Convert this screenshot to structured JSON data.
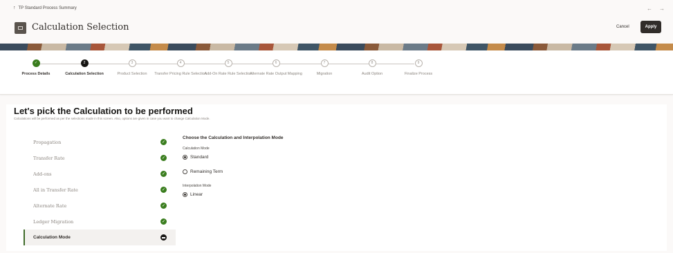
{
  "breadcrumb": {
    "label": "TP Standard Process Summary"
  },
  "header": {
    "title": "Calculation Selection",
    "cancel_label": "Cancel",
    "apply_label": "Apply"
  },
  "train": {
    "steps": [
      {
        "label": "Process Details",
        "state": "done",
        "glyph": "✓"
      },
      {
        "label": "Calculation Selection",
        "state": "current",
        "glyph": "2"
      },
      {
        "label": "Product Selection",
        "state": "pending",
        "glyph": "3"
      },
      {
        "label": "Transfer Pricing Rule Selection",
        "state": "pending",
        "glyph": "4"
      },
      {
        "label": "Add-On Rate Rule Selection",
        "state": "pending",
        "glyph": "5"
      },
      {
        "label": "Alternate Rate Output Mapping",
        "state": "pending",
        "glyph": "6"
      },
      {
        "label": "Migration",
        "state": "pending",
        "glyph": "7"
      },
      {
        "label": "Audit Option",
        "state": "pending",
        "glyph": "8"
      },
      {
        "label": "Finalize Process",
        "state": "pending",
        "glyph": "9"
      }
    ]
  },
  "main": {
    "heading": "Let's pick the Calculation to be performed",
    "subtext": "Calculations will be performed as per the selections made in this screen. Also, options are given in case you want to change Calculation Mode.",
    "calculations": [
      {
        "label": "Propagation",
        "status": "done"
      },
      {
        "label": "Transfer Rate",
        "status": "done"
      },
      {
        "label": "Add-ons",
        "status": "done"
      },
      {
        "label": "All in Transfer Rate",
        "status": "done"
      },
      {
        "label": "Alternate Rate",
        "status": "done"
      },
      {
        "label": "Ledger Migration",
        "status": "done"
      },
      {
        "label": "Calculation Mode",
        "status": "current"
      }
    ],
    "detail": {
      "title": "Choose the Calculation and Interpolation Mode",
      "calc_mode_label": "Calculation Mode",
      "calc_options": [
        {
          "label": "Standard",
          "checked": true
        },
        {
          "label": "Remaining Term",
          "checked": false
        }
      ],
      "interp_mode_label": "Interpolation Mode",
      "interp_options": [
        {
          "label": "Linear",
          "checked": true
        }
      ]
    }
  },
  "colors": {
    "done": "#3a7d1e",
    "current": "#161513",
    "accent_bar": "#3f6b2a",
    "apply_bg": "#312d2a"
  },
  "icons": [
    "up-arrow-icon",
    "back-arrow-icon",
    "forward-arrow-icon",
    "page-icon",
    "check-icon"
  ]
}
